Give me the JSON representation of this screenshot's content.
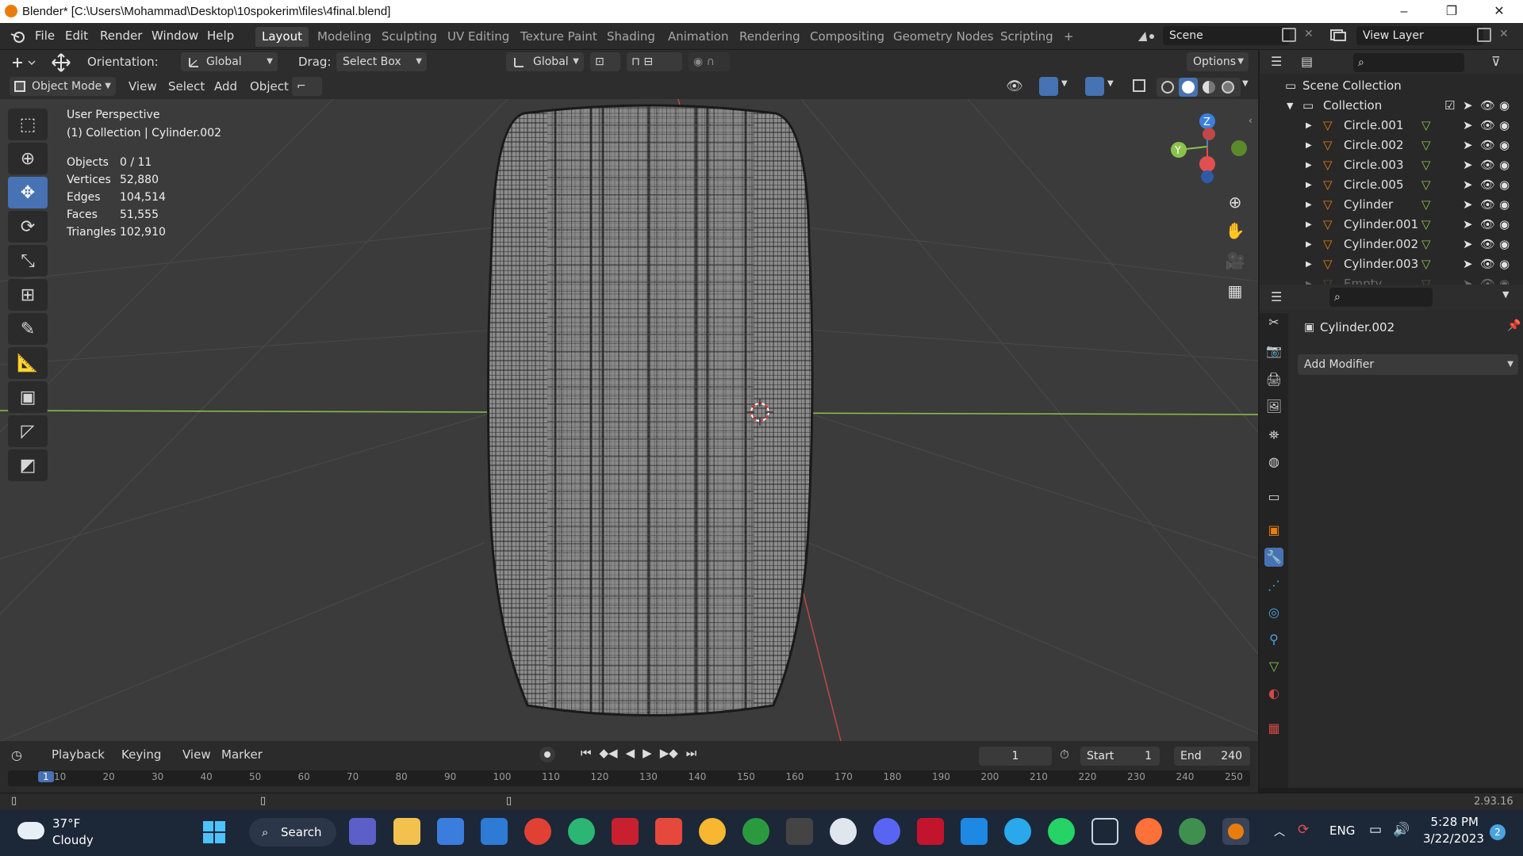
{
  "titlebar": {
    "title": "Blender* [C:\\Users\\Mohammad\\Desktop\\10spokerim\\files\\4final.blend]",
    "min": "–",
    "max": "❐",
    "close": "✕"
  },
  "menus": [
    "File",
    "Edit",
    "Render",
    "Window",
    "Help"
  ],
  "workspaces": [
    "Layout",
    "Modeling",
    "Sculpting",
    "UV Editing",
    "Texture Paint",
    "Shading",
    "Animation",
    "Rendering",
    "Compositing",
    "Geometry Nodes",
    "Scripting",
    "+"
  ],
  "scene": {
    "name": "Scene",
    "view_layer": "View Layer"
  },
  "toolheader": {
    "orientation_label": "Orientation:",
    "orientation_value": "Global",
    "drag_label": "Drag:",
    "drag_value": "Select Box",
    "transform_orientation": "Global",
    "options": "Options"
  },
  "viewheader": {
    "mode": "Object Mode",
    "items": [
      "View",
      "Select",
      "Add",
      "Object"
    ]
  },
  "viewport": {
    "perspective": "User Perspective",
    "collection": "(1) Collection | Cylinder.002",
    "stats": [
      {
        "label": "Objects",
        "value": "0 / 11"
      },
      {
        "label": "Vertices",
        "value": "52,880"
      },
      {
        "label": "Edges",
        "value": "104,514"
      },
      {
        "label": "Faces",
        "value": "51,555"
      },
      {
        "label": "Triangles",
        "value": "102,910"
      }
    ],
    "gizmo": {
      "z": "Z",
      "y": "Y",
      "x": "X"
    }
  },
  "outliner": {
    "scene_collection": "Scene Collection",
    "collection": "Collection",
    "items": [
      "Circle.001",
      "Circle.002",
      "Circle.003",
      "Circle.005",
      "Cylinder",
      "Cylinder.001",
      "Cylinder.002",
      "Cylinder.003",
      "Empty"
    ]
  },
  "properties": {
    "object_name": "Cylinder.002",
    "add_modifier": "Add Modifier"
  },
  "timeline": {
    "menus": [
      "Playback",
      "Keying",
      "View",
      "Marker"
    ],
    "current_frame": "1",
    "start_label": "Start",
    "start_value": "1",
    "end_label": "End",
    "end_value": "240",
    "ruler": [
      "1",
      "10",
      "20",
      "30",
      "40",
      "50",
      "60",
      "70",
      "80",
      "90",
      "100",
      "110",
      "120",
      "130",
      "140",
      "150",
      "160",
      "170",
      "180",
      "190",
      "200",
      "210",
      "220",
      "230",
      "240",
      "250"
    ]
  },
  "statusbar": {
    "version": "2.93.16"
  },
  "taskbar": {
    "weather_temp": "37°F",
    "weather_desc": "Cloudy",
    "search": "Search",
    "lang": "ENG",
    "time": "5:28 PM",
    "date": "3/22/2023",
    "notif_count": "2"
  },
  "colors": {
    "accent": "#4772b3",
    "orange": "#e87d0d",
    "axis_x": "#e05050",
    "axis_y": "#8ac34a",
    "axis_z": "#3a7fe0"
  }
}
